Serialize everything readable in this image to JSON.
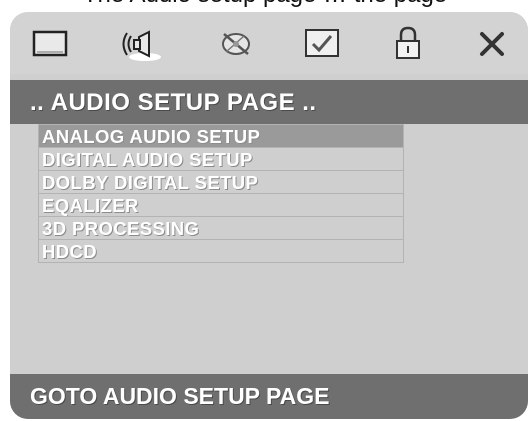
{
  "top_caption": "The Audio setup page … the page",
  "icon_bar": {
    "items": [
      {
        "icon": "general-setup-icon"
      },
      {
        "icon": "audio-setup-icon",
        "active": true
      },
      {
        "icon": "video-setup-icon"
      },
      {
        "icon": "preference-icon"
      },
      {
        "icon": "password-icon"
      },
      {
        "icon": "exit-icon"
      }
    ]
  },
  "header": {
    "title": ".. AUDIO SETUP PAGE .."
  },
  "menu": {
    "items": [
      {
        "label": "ANALOG AUDIO SETUP",
        "selected": true
      },
      {
        "label": "DIGITAL AUDIO SETUP"
      },
      {
        "label": "DOLBY DIGITAL SETUP"
      },
      {
        "label": "EQALIZER"
      },
      {
        "label": "3D PROCESSING"
      },
      {
        "label": "HDCD"
      }
    ]
  },
  "status": {
    "text": "GOTO AUDIO SETUP PAGE"
  },
  "colors": {
    "panel": "#cfcfcf",
    "bar": "#6f6f6f",
    "selected": "#9a9a9a",
    "text": "#ffffff"
  }
}
